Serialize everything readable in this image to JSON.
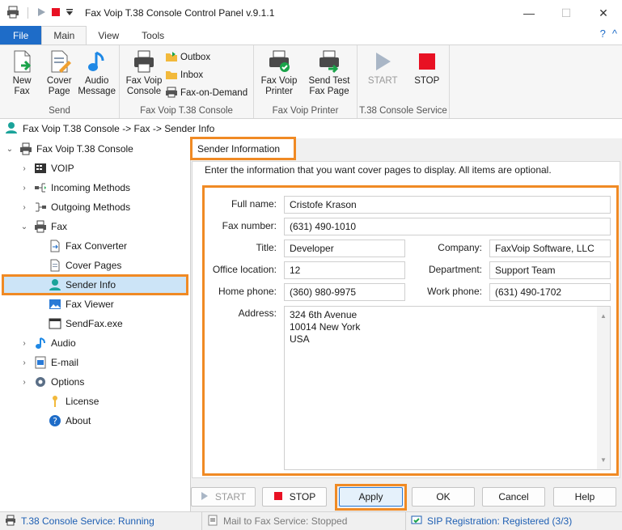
{
  "window": {
    "title": "Fax Voip T.38 Console Control Panel v.9.1.1",
    "minimize_glyph": "—",
    "maximize_glyph": "☐",
    "close_glyph": "✕"
  },
  "ribbon_tabs": [
    "File",
    "Main",
    "View",
    "Tools"
  ],
  "ribbon_right": {
    "help_glyph": "?",
    "collapse_glyph": "^"
  },
  "ribbon": {
    "send_group": {
      "label": "Send",
      "new_fax": [
        "New",
        "Fax"
      ],
      "cover_page": [
        "Cover",
        "Page"
      ],
      "audio_message": [
        "Audio",
        "Message"
      ]
    },
    "console_group": {
      "label": "Fax Voip T.38 Console",
      "console_btn": [
        "Fax Voip",
        "Console"
      ],
      "outbox": "Outbox",
      "inbox": "Inbox",
      "fax_on_demand": "Fax-on-Demand"
    },
    "printer_group": {
      "label": "Fax Voip Printer",
      "printer_btn": [
        "Fax Voip",
        "Printer"
      ],
      "test_btn": [
        "Send Test",
        "Fax Page"
      ]
    },
    "service_group": {
      "label": "T.38 Console Service",
      "start": "START",
      "stop": "STOP"
    }
  },
  "breadcrumb": "Fax Voip T.38 Console -> Fax -> Sender Info",
  "tree": {
    "root": "Fax Voip T.38 Console",
    "voip": "VOIP",
    "incoming": "Incoming Methods",
    "outgoing": "Outgoing Methods",
    "fax": "Fax",
    "fax_converter": "Fax Converter",
    "cover_pages": "Cover Pages",
    "sender_info": "Sender Info",
    "fax_viewer": "Fax Viewer",
    "sendfax": "SendFax.exe",
    "audio": "Audio",
    "email": "E-mail",
    "options": "Options",
    "license": "License",
    "about": "About"
  },
  "section_title": "Sender Information",
  "intro": "Enter the information that you want cover pages to display. All items are optional.",
  "form": {
    "full_name_label": "Full name:",
    "full_name": "Cristofe Krason",
    "fax_number_label": "Fax number:",
    "fax_number": "(631) 490-1010",
    "title_label": "Title:",
    "title": "Developer",
    "company_label": "Company:",
    "company": "FaxVoip Software, LLC",
    "office_label": "Office location:",
    "office": "12",
    "department_label": "Department:",
    "department": "Support Team",
    "home_phone_label": "Home phone:",
    "home_phone": "(360) 980-9975",
    "work_phone_label": "Work phone:",
    "work_phone": "(631) 490-1702",
    "address_label": "Address:",
    "address_lines": [
      "324 6th Avenue",
      "10014 New York",
      "USA"
    ]
  },
  "buttons": {
    "start": "START",
    "stop": "STOP",
    "apply": "Apply",
    "ok": "OK",
    "cancel": "Cancel",
    "help": "Help"
  },
  "status": {
    "console_service": "T.38 Console Service: Running",
    "mail_service": "Mail to Fax Service: Stopped",
    "sip": "SIP Registration: Registered (3/3)"
  },
  "colors": {
    "accent": "#1e6cc8",
    "highlight": "#f08a24",
    "stop_red": "#e81123"
  }
}
